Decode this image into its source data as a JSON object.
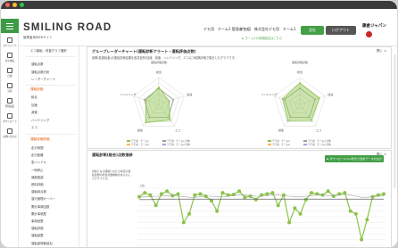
{
  "app": {
    "logo": "SMILING ROAD",
    "subtitle": "管理者用WEBサイト",
    "user_name": "デモ用　チーム1 管理者さん",
    "company": "デモ用　株式会社デモ用　チーム1",
    "settings_link": "► チーム1の詳細設定はこちら",
    "mode_button": "全社",
    "logout_button": "ログアウト",
    "brand": "藤倉ジャパン",
    "accent_color": "#43a047"
  },
  "iconbar": {
    "items": [
      {
        "label": "スケジュール",
        "icon": "calendar-icon"
      },
      {
        "label": "安全運転",
        "icon": "car-icon"
      },
      {
        "label": "日報",
        "icon": "document-icon"
      },
      {
        "label": "分析",
        "icon": "chart-icon"
      },
      {
        "label": "管理設定",
        "icon": "gear-icon"
      },
      {
        "label": "ダウンロード",
        "icon": "download-icon"
      },
      {
        "label": "お問い合わせ",
        "icon": "mail-icon"
      }
    ]
  },
  "sidenav": {
    "top_item": "エコ運転・改善グラフ選択",
    "section_general": "",
    "general_items": [
      "運転点数",
      "運転点数分析",
      "レーダーチャート"
    ],
    "section_score": "運転評価",
    "score_items": [
      "総合",
      "加速",
      "減速",
      "ハンドリング",
      "エコ"
    ],
    "section_detail": "運転詳細評価",
    "detail_items": [
      "走行時間",
      "走行距離",
      "急ハンドル",
      "一時停止",
      "速度超過",
      "燃料評価",
      "運転時点検",
      "運行管理オーバー",
      "累計事故回数",
      "累計事故歴",
      "事故経歴",
      "運転評価",
      "運転経歴",
      "運転者情報追加"
    ]
  },
  "panel_radar": {
    "title": "グループレーダーチャート(運転診断アラート・運転評価点数)",
    "description": "各車(各運転者)の運転診断結果を各項目別(加速、減速、ハンドリング、エコ)に5段階評価で集計したグラフです。",
    "close_label": "開く ×",
    "chart_left_title": "運転評価点数",
    "chart_right_title": "運転評価点数",
    "axes": [
      "総合",
      "加速",
      "エコ",
      "減速",
      "ハンドリング"
    ],
    "legend": [
      "デモ用　チーム1",
      "デモ用　チーム1 全体",
      "デモ用　チーム2",
      "デモ用　チーム2 全体"
    ]
  },
  "panel_score": {
    "title": "運転診断(総合)点数推移",
    "close_label": "開く ×",
    "description": "対象となる期間における毎日の運転診断の総合点数推移をあらわしたグラフです。",
    "export_button": "► ダウンロード(csv形式)で集計データの出力",
    "y_unit": "(点)"
  },
  "chart_data": [
    {
      "type": "radar",
      "title": "運転評価点数",
      "axes": [
        "総合",
        "加速",
        "エコ",
        "減速",
        "ハンドリング"
      ],
      "series": [
        {
          "name": "デモ用　チーム1",
          "values": [
            3.2,
            2.0,
            3.6,
            4.2,
            2.5
          ],
          "color": "#8bc34a"
        },
        {
          "name": "デモ用　チーム1 全体",
          "values": [
            3.0,
            2.8,
            3.0,
            3.0,
            2.8
          ],
          "color": "#9e9e9e"
        }
      ],
      "rmax": 5
    },
    {
      "type": "radar",
      "title": "運転評価点数",
      "axes": [
        "総合",
        "加速",
        "エコ",
        "減速",
        "ハンドリング"
      ],
      "series": [
        {
          "name": "デモ用　チーム1",
          "values": [
            4.0,
            3.8,
            3.7,
            3.8,
            3.4
          ],
          "color": "#8bc34a"
        },
        {
          "name": "デモ用　チーム1 全体",
          "values": [
            3.0,
            3.0,
            3.0,
            3.0,
            3.0
          ],
          "color": "#9e9e9e"
        }
      ],
      "rmax": 5
    },
    {
      "type": "line",
      "series": [
        {
          "name": "デモ用　チーム1",
          "color": "#8bc34a",
          "values": [
            85,
            92,
            88,
            70,
            90,
            95,
            87,
            90,
            40,
            55,
            88,
            90,
            86,
            78,
            60,
            92,
            88,
            89,
            95,
            84,
            86,
            80,
            88,
            90,
            92,
            70,
            88,
            40,
            65,
            55,
            80,
            92,
            90,
            88,
            95,
            86,
            90,
            92,
            60,
            55,
            10,
            45,
            85,
            88,
            90
          ]
        },
        {
          "name": "デモ用　チーム1 全体",
          "color": "#9e9e9e",
          "values": [
            84,
            85,
            85,
            86,
            86,
            87,
            87,
            86,
            85,
            84,
            84,
            85,
            86,
            86,
            85,
            85,
            86,
            87,
            88,
            88,
            87,
            86,
            86,
            87,
            88,
            88,
            87,
            86,
            85,
            85,
            86,
            87,
            88,
            88,
            87,
            87,
            88,
            89,
            88,
            86,
            84,
            84,
            85,
            86,
            87
          ]
        },
        {
          "name": "平均",
          "color": "#555555",
          "values": [
            80,
            80,
            80,
            81,
            81,
            81,
            81,
            81,
            81,
            81,
            81,
            81,
            81,
            81,
            81,
            81,
            81,
            81,
            81,
            81,
            81,
            81,
            81,
            81,
            81,
            81,
            81,
            81,
            81,
            81,
            81,
            81,
            81,
            81,
            81,
            81,
            81,
            81,
            81,
            81,
            81,
            81,
            81,
            81,
            81
          ]
        }
      ],
      "ylim": [
        0,
        100
      ],
      "grid": true
    }
  ]
}
